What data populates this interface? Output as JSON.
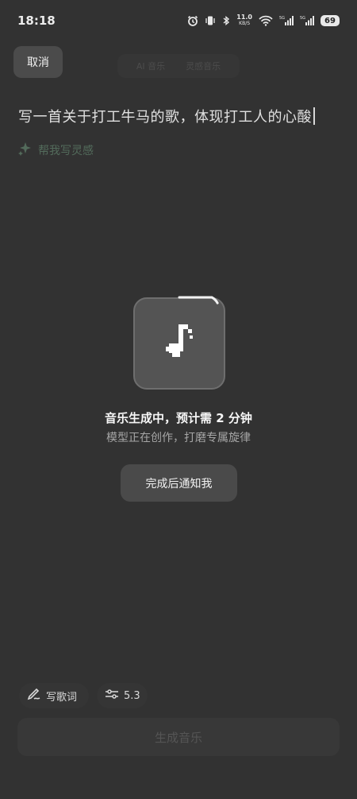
{
  "status_bar": {
    "time": "18:18",
    "net_speed_value": "11.0",
    "net_speed_unit": "KB/S",
    "battery": "69",
    "icons": [
      "alarm-icon",
      "vibrate-icon",
      "bluetooth-icon",
      "wifi-icon",
      "signal-5g-icon",
      "signal-5g-icon"
    ]
  },
  "header": {
    "cancel_label": "取消",
    "tabs": [
      "AI 音乐",
      "灵感音乐"
    ]
  },
  "prompt": {
    "text": "写一首关于打工牛马的歌，体现打工人的心酸",
    "inspire_label": "帮我写灵感",
    "inspire_icon": "sparkle-icon",
    "inspire_color": "#536b5b"
  },
  "generating": {
    "icon": "music-note-icon",
    "progress": 0.12,
    "title": "音乐生成中，预计需 2 分钟",
    "subtitle": "模型正在创作，打磨专属旋律",
    "notify_label": "完成后通知我"
  },
  "toolbar": {
    "lyrics_label": "写歌词",
    "lyrics_icon": "pen-icon",
    "model_label": "5.3",
    "model_icon": "sliders-icon"
  },
  "generate_label": "生成音乐",
  "colors": {
    "background": "#323232",
    "overlay_button": "#4a4a4a"
  }
}
